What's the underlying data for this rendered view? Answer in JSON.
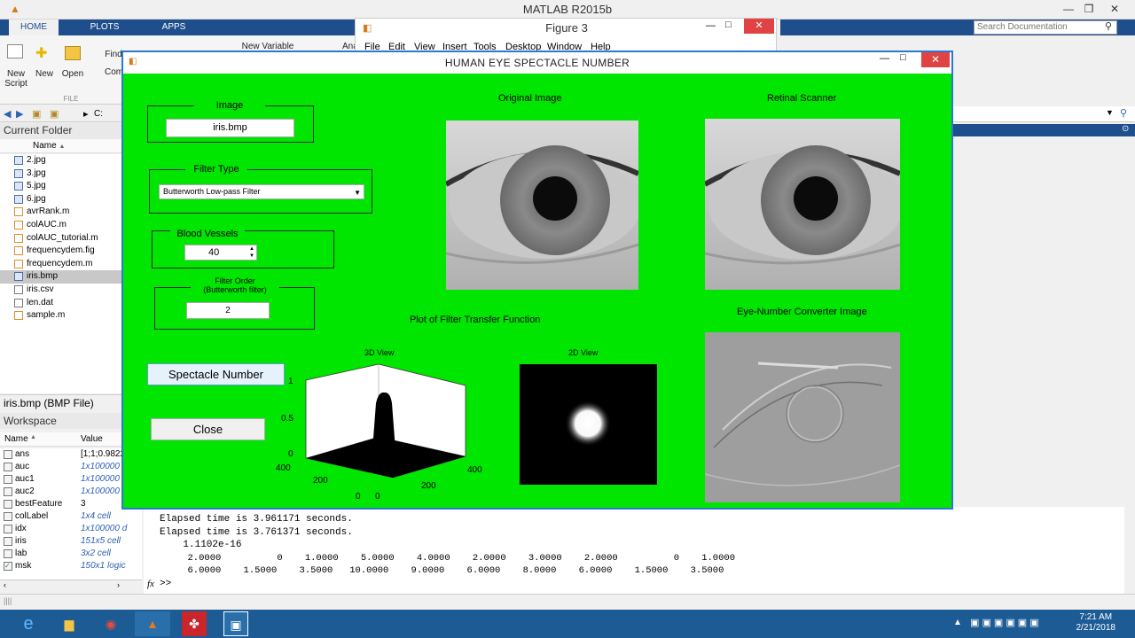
{
  "app": {
    "title": "MATLAB R2015b",
    "tabs": [
      "HOME",
      "PLOTS",
      "APPS"
    ],
    "search_placeholder": "Search Documentation"
  },
  "ribbon": {
    "new_script": "New\nScript",
    "new": "New",
    "open": "Open",
    "find": "Find",
    "compare": "Com",
    "new_variable": "New Variable",
    "analyze": "Ana",
    "section_file": "FILE"
  },
  "figure3": {
    "title": "Figure 3",
    "menu": [
      "File",
      "Edit",
      "View",
      "Insert",
      "Tools",
      "Desktop",
      "Window",
      "Help"
    ]
  },
  "address": {
    "path": "C:"
  },
  "current_folder": {
    "title": "Current Folder",
    "column_name": "Name",
    "files": [
      "2.jpg",
      "3.jpg",
      "5.jpg",
      "6.jpg",
      "avrRank.m",
      "colAUC.m",
      "colAUC_tutorial.m",
      "frequencydem.fig",
      "frequencydem.m",
      "iris.bmp",
      "iris.csv",
      "len.dat",
      "sample.m"
    ],
    "selected": "iris.bmp",
    "details": "iris.bmp  (BMP File)"
  },
  "workspace": {
    "title": "Workspace",
    "col_name": "Name",
    "col_value": "Value",
    "vars": [
      {
        "name": "ans",
        "value": "[1;1;0.9822"
      },
      {
        "name": "auc",
        "value": "1x100000"
      },
      {
        "name": "auc1",
        "value": "1x100000"
      },
      {
        "name": "auc2",
        "value": "1x100000"
      },
      {
        "name": "bestFeature",
        "value": "3"
      },
      {
        "name": "colLabel",
        "value": "1x4 cell"
      },
      {
        "name": "idx",
        "value": "1x100000 d"
      },
      {
        "name": "iris",
        "value": "151x5 cell"
      },
      {
        "name": "lab",
        "value": "3x2 cell"
      },
      {
        "name": "msk",
        "value": "150x1 logic"
      }
    ]
  },
  "command": {
    "lines": [
      "Elapsed time is 3.961171 seconds.",
      "Elapsed time is 3.761371 seconds.",
      "    1.1102e-16",
      "     2.0000          0    1.0000    5.0000    4.0000    2.0000    3.0000    2.0000          0    1.0000",
      "     6.0000    1.5000    3.5000   10.0000    9.0000    6.0000    8.0000    6.0000    1.5000    3.5000"
    ],
    "prompt": ">>",
    "fx": "fx"
  },
  "gui": {
    "title": "HUMAN EYE SPECTACLE NUMBER",
    "image_panel": {
      "title": "Image",
      "value": "iris.bmp"
    },
    "filter_panel": {
      "title": "Filter Type",
      "selected": "Butterworth Low-pass Filter"
    },
    "vessels_panel": {
      "title": "Blood Vessels",
      "value": "40"
    },
    "order_panel": {
      "title": "Filter Order",
      "subtitle": "(Butterworth filter)",
      "value": "2"
    },
    "spectacle_button": "Spectacle Number",
    "close_button": "Close",
    "original_label": "Original Image",
    "retinal_label": "Retinal Scanner",
    "plot_label": "Plot of Filter Transfer Function",
    "view3d_label": "3D View",
    "view2d_label": "2D View",
    "converter_label": "Eye-Number Converter Image",
    "axis3d": {
      "z_ticks": [
        "1",
        "0.5",
        "0"
      ],
      "left_ticks": [
        "400",
        "200",
        "0"
      ],
      "right_ticks": [
        "0",
        "200",
        "400"
      ]
    }
  },
  "taskbar": {
    "time": "7:21 AM",
    "date": "2/21/2018"
  },
  "colors": {
    "gui_bg": "#00e600",
    "titlebar_blue": "#1f4e8c",
    "taskbar": "#1d5b95"
  }
}
